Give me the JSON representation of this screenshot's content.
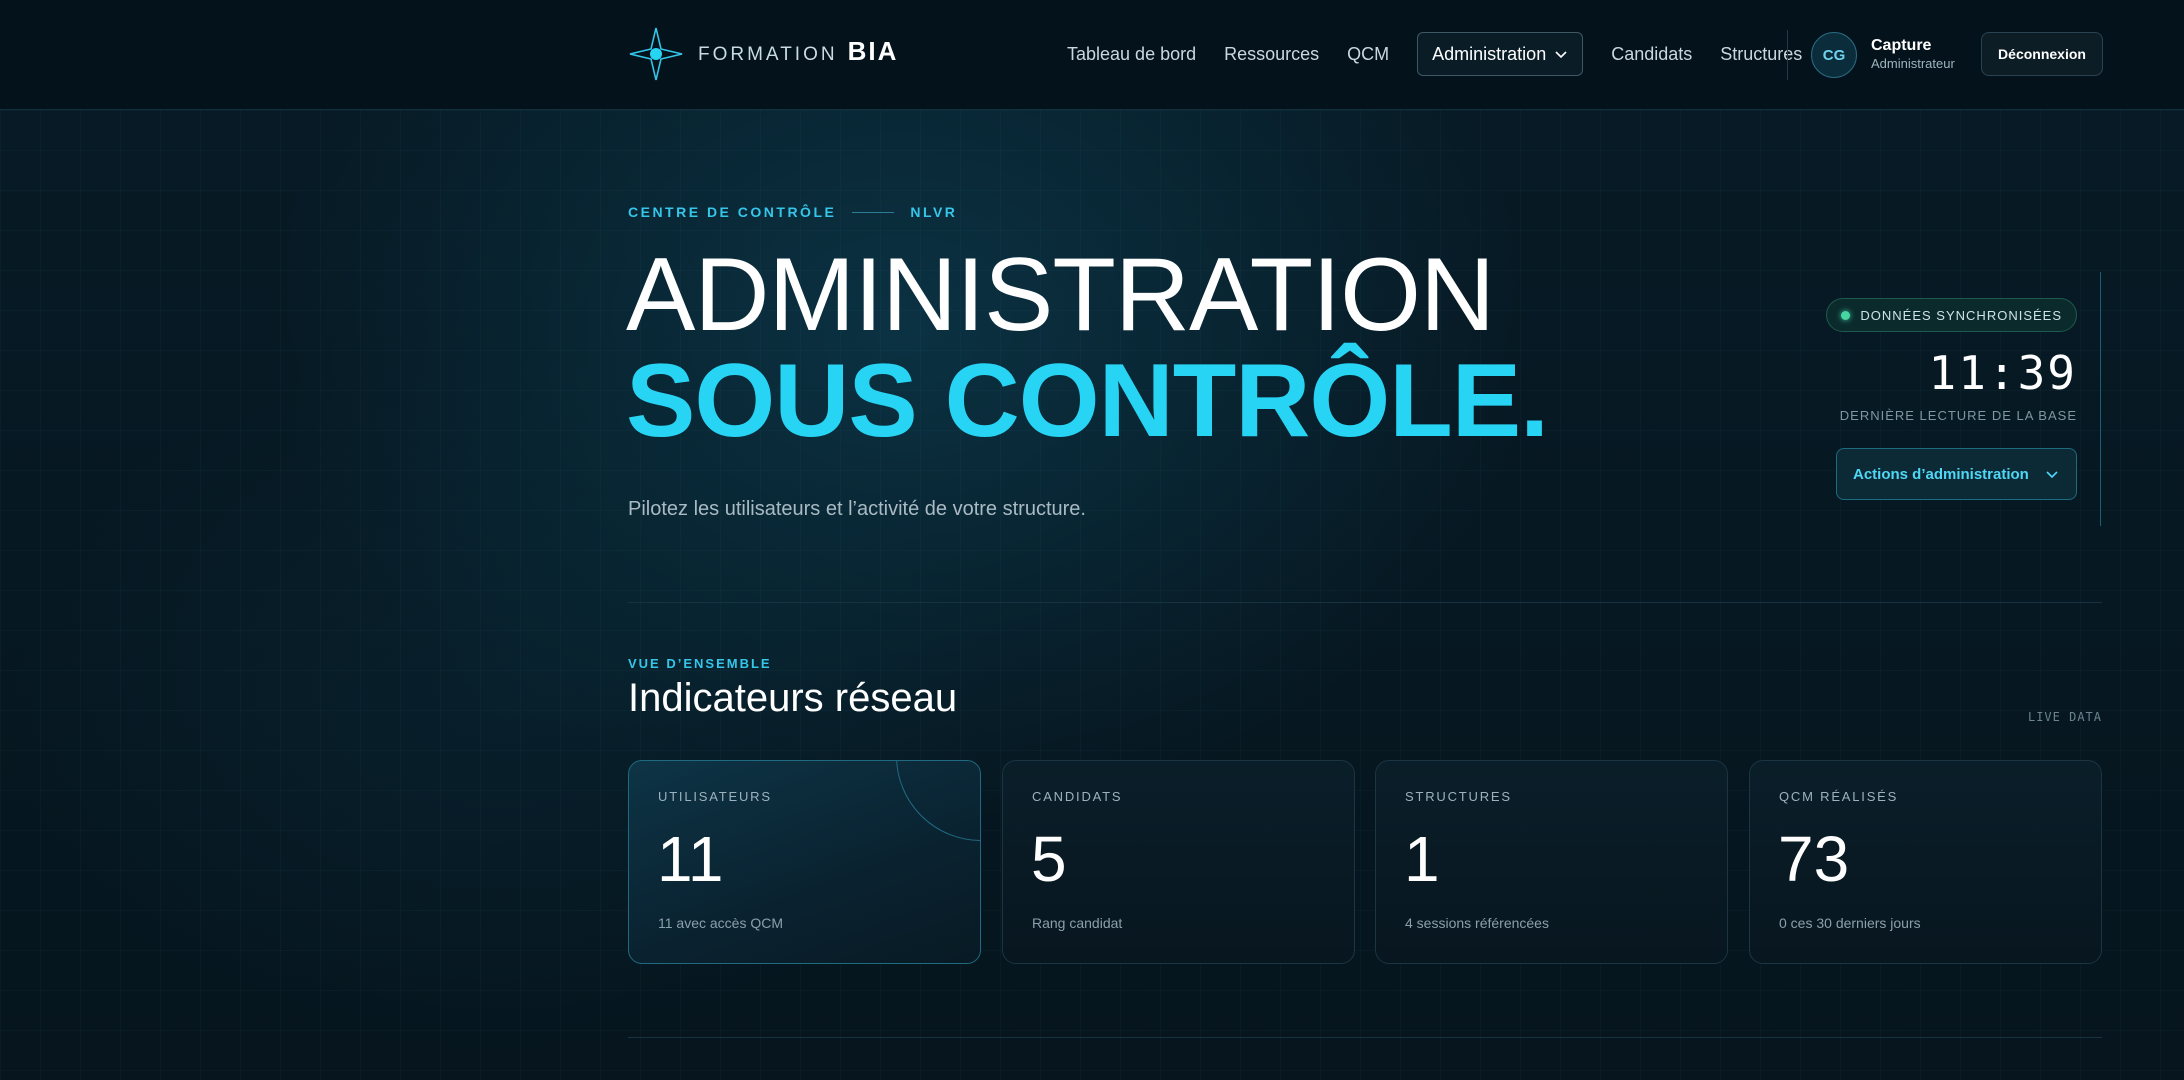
{
  "header": {
    "brand_light": "FORMATION",
    "brand_bold": "BIA",
    "nav": {
      "dashboard": "Tableau de bord",
      "resources": "Ressources",
      "qcm": "QCM",
      "administration": "Administration",
      "candidates": "Candidats",
      "structures": "Structures"
    },
    "user": {
      "initials": "CG",
      "name": "Capture",
      "role": "Administrateur"
    },
    "logout_label": "Déconnexion"
  },
  "hero": {
    "eyebrow": "CENTRE DE CONTRÔLE",
    "eyebrow_code": "NLVR",
    "title_line1": "ADMINISTRATION",
    "title_line2": "SOUS CONTRÔLE.",
    "subtitle": "Pilotez les utilisateurs et l’activité de votre structure."
  },
  "status": {
    "sync_label": "DONNÉES SYNCHRONISÉES",
    "time": "11:39",
    "time_label": "DERNIÈRE LECTURE DE LA BASE",
    "actions_label": "Actions d’administration"
  },
  "overview": {
    "eyebrow": "VUE D’ENSEMBLE",
    "title": "Indicateurs réseau",
    "live_label": "LIVE DATA",
    "cards": [
      {
        "label": "UTILISATEURS",
        "value": "11",
        "note": "11 avec accès QCM"
      },
      {
        "label": "CANDIDATS",
        "value": "5",
        "note": "Rang candidat"
      },
      {
        "label": "STRUCTURES",
        "value": "1",
        "note": "4 sessions référencées"
      },
      {
        "label": "QCM RÉALISÉS",
        "value": "73",
        "note": "0 ces 30 derniers jours"
      }
    ]
  },
  "colors": {
    "accent": "#27d4f4",
    "background": "#061620",
    "sync_dot": "#45d6a4"
  },
  "icons": {
    "logo": "compass-star-icon",
    "dropdown": "chevron-down-icon",
    "status": "status-dot-icon"
  }
}
